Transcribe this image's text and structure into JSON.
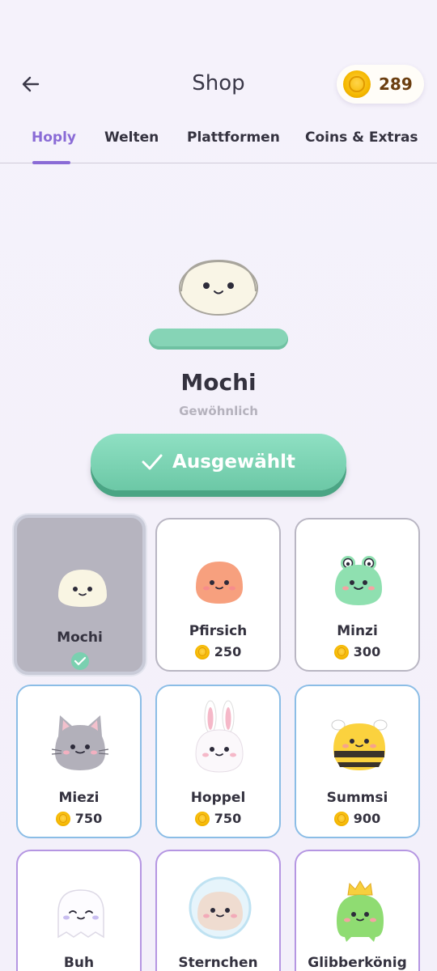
{
  "header": {
    "title": "Shop",
    "coins": "289"
  },
  "tabs": [
    {
      "label": "Hoply",
      "active": true
    },
    {
      "label": "Welten",
      "active": false
    },
    {
      "label": "Plattformen",
      "active": false
    },
    {
      "label": "Coins & Extras",
      "active": false
    }
  ],
  "preview": {
    "name": "Mochi",
    "rarity": "Gewöhnlich",
    "button_label": "Ausgewählt"
  },
  "characters": [
    {
      "name": "Mochi",
      "selected": true,
      "icon": "mochi-icon"
    },
    {
      "name": "Pfirsich",
      "price": "250",
      "icon": "pfirsich-icon"
    },
    {
      "name": "Minzi",
      "price": "300",
      "icon": "minzi-frog-icon"
    },
    {
      "name": "Miezi",
      "price": "750",
      "icon": "miezi-cat-icon"
    },
    {
      "name": "Hoppel",
      "price": "750",
      "icon": "hoppel-bunny-icon"
    },
    {
      "name": "Summsi",
      "price": "900",
      "icon": "summsi-bee-icon"
    },
    {
      "name": "Buh",
      "icon": "buh-ghost-icon"
    },
    {
      "name": "Sternchen",
      "icon": "sternchen-astronaut-icon"
    },
    {
      "name": "Glibberkönig",
      "icon": "glibberkoenig-crown-icon"
    }
  ],
  "colors": {
    "accent": "#8a6bd6",
    "button": "#6cc8a6",
    "background": "#f4f1fa"
  }
}
